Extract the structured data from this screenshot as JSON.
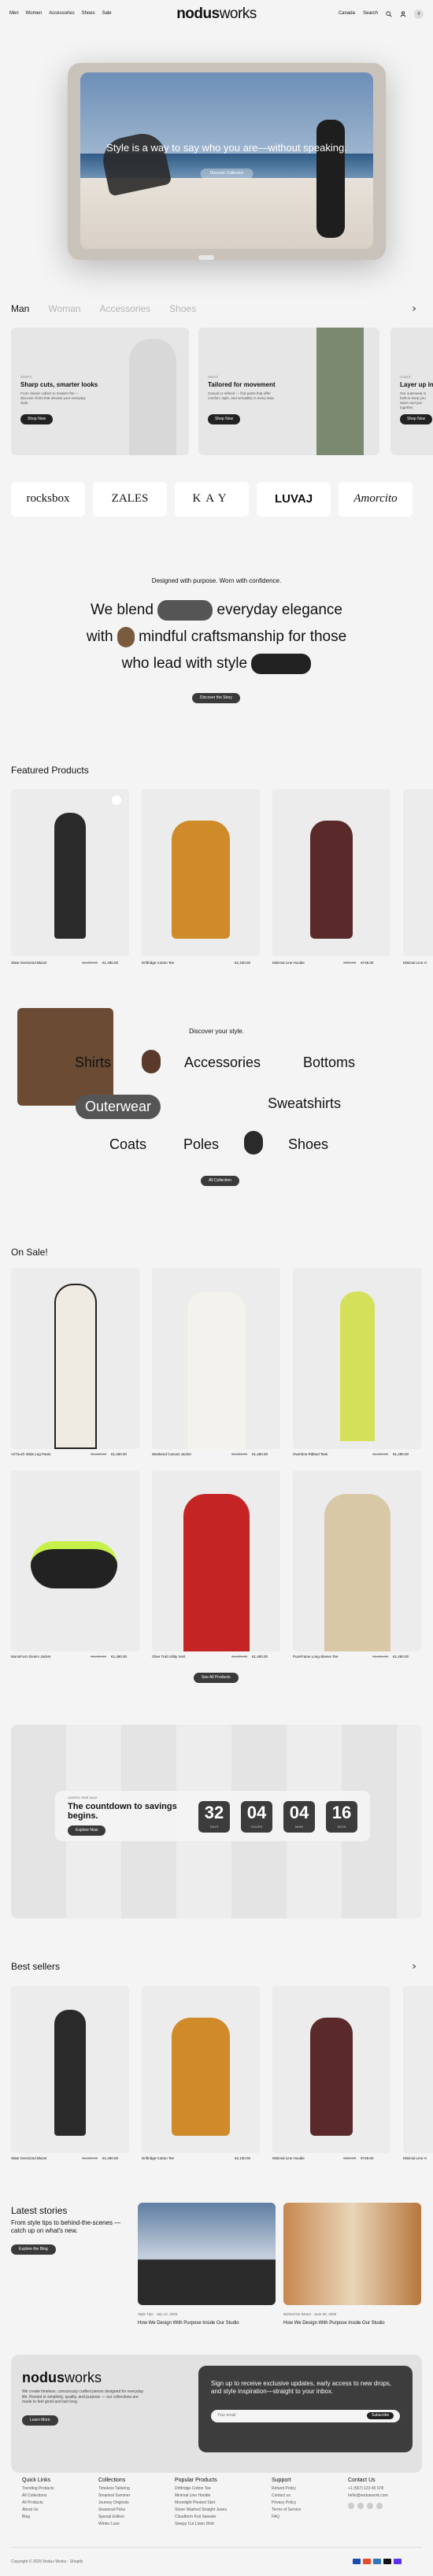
{
  "nav": {
    "left": [
      "Men",
      "Women",
      "Accessories",
      "Shoes",
      "Sale"
    ],
    "logo_bold": "nodus",
    "logo_light": "works",
    "region": "Canada",
    "search": "Search",
    "icons": [
      "search-icon",
      "account-icon",
      "cart-icon"
    ],
    "cart_count": "0"
  },
  "hero": {
    "headline": "Style is a way to say who you are—without speaking.",
    "button": "Discover Collection"
  },
  "tabs": [
    "Man",
    "Woman",
    "Accessories",
    "Shoes"
  ],
  "cards": [
    {
      "kicker": "SHIRTS",
      "title": "Sharp cuts, smarter looks",
      "desc": "From classic collars to modern fits — discover shirts that elevate your everyday style.",
      "button": "Shop Now"
    },
    {
      "kicker": "PANTS",
      "title": "Tailored for movement",
      "desc": "Casual or refined — find pants that offer comfort, style, and versatility in every step.",
      "button": "Shop Now"
    },
    {
      "kicker": "COATS",
      "title": "Layer up in style",
      "desc": "Our outerwear is built to keep you warm and put-together.",
      "button": "Shop Now"
    }
  ],
  "brands": [
    "rocksbox",
    "ZALES",
    "KAY",
    "LUVAJ",
    "Amorcito"
  ],
  "blend": {
    "kicker": "Designed with purpose. Worn with confidence.",
    "line1a": "We blend",
    "line1b": "everyday elegance",
    "line2a": "with",
    "line2b": "mindful craftsmanship for those",
    "line3a": "who lead with style",
    "button": "Discover the Story"
  },
  "featured": {
    "title": "Featured Products",
    "items": [
      {
        "name": "Slate Oversized Blazer",
        "old": "€1,890.00",
        "price": "€1,490.00"
      },
      {
        "name": "Driftridge Cotton Tee",
        "old": "",
        "price": "€2,100.00"
      },
      {
        "name": "Minimal Line Hoodie",
        "old": "€890.00",
        "price": "€749.00"
      },
      {
        "name": "Minimal Line H",
        "old": "",
        "price": ""
      }
    ]
  },
  "discover": {
    "kicker": "Discover your style.",
    "cats": [
      "Shirts",
      "Accessories",
      "Bottoms",
      "Outerwear",
      "Sweatshirts",
      "Coats",
      "Poles",
      "Shoes"
    ],
    "button": "All Collection"
  },
  "sale": {
    "title": "On Sale!",
    "items": [
      {
        "name": "AirTouch Wide Leg Pants",
        "old": "€1,890.00",
        "price": "€1,490.00"
      },
      {
        "name": "Weekend Canvas Jacket",
        "old": "€1,890.00",
        "price": "€1,490.00"
      },
      {
        "name": "Overtime Ribbed Tank",
        "old": "€1,890.00",
        "price": "€1,490.00"
      },
      {
        "name": "MonoForm Denim Jacket",
        "old": "€1,890.00",
        "price": "€1,490.00"
      },
      {
        "name": "Olive Trail Utility Vest",
        "old": "€1,890.00",
        "price": "€1,490.00"
      },
      {
        "name": "PureFrame Long-Sleeve Tee",
        "old": "€1,890.00",
        "price": "€1,490.00"
      }
    ],
    "button": "See All Products"
  },
  "countdown": {
    "kicker": "LIMITED TIME SALE",
    "title": "The countdown to savings begins.",
    "button": "Explore Now",
    "units": [
      {
        "value": "32",
        "label": "DAYS"
      },
      {
        "value": "04",
        "label": "HOURS"
      },
      {
        "value": "04",
        "label": "MINS"
      },
      {
        "value": "16",
        "label": "SECS"
      }
    ]
  },
  "best": {
    "title": "Best sellers",
    "items": [
      {
        "name": "Slate Oversized Blazer",
        "old": "€1,890.00",
        "price": "€1,490.00"
      },
      {
        "name": "Driftridge Cotton Tee",
        "old": "",
        "price": "€2,100.00"
      },
      {
        "name": "Minimal Line Hoodie",
        "old": "€890.00",
        "price": "€749.00"
      },
      {
        "name": "Minimal Line H",
        "old": "",
        "price": ""
      }
    ]
  },
  "stories": {
    "title": "Latest stories",
    "desc": "From style tips to behind-the-scenes — catch up on what's new.",
    "button": "Explore the Blog",
    "posts": [
      {
        "tag": "Style Tips",
        "date": "July 12, 2025",
        "title": "How We Design With Purpose Inside Our Studio"
      },
      {
        "tag": "Behind the Brand",
        "date": "June 30, 2025",
        "title": "How We Design With Purpose Inside Our Studio"
      }
    ]
  },
  "footer": {
    "logo_bold": "nodus",
    "logo_light": "works",
    "about": "We create timeless, consciously crafted pieces designed for everyday life. Rooted in simplicity, quality, and purpose — our collections are made to feel good and last long.",
    "learn": "Learn More",
    "news": "Sign up to receive exclusive updates, early access to new drops, and style inspiration—straight to your inbox.",
    "email_placeholder": "Your email",
    "subscribe": "Subscribe",
    "cols": [
      {
        "title": "Quick Links",
        "items": [
          "Trending Products",
          "All Collections",
          "All Products",
          "About Us",
          "Blog"
        ]
      },
      {
        "title": "Collections",
        "items": [
          "Timeless Tailoring",
          "Smartest Summer",
          "Joumey Originals",
          "Seasonal Picks",
          "Special Edition",
          "Winter Luxe"
        ]
      },
      {
        "title": "Popular Products",
        "items": [
          "Driftridge Cotton Tee",
          "Minimal Line Hoodie",
          "Moonlight Pleated Skirt",
          "Stone Washed Straight Jeans",
          "Cloudform Knit Sweater",
          "Sleepy Cut Linen Shirt"
        ]
      },
      {
        "title": "Support",
        "items": [
          "Refund Policy",
          "Contact us",
          "Privacy Policy",
          "Terms of Service",
          "FAQ"
        ]
      },
      {
        "title": "Contact Us",
        "items": [
          "+1 (567) 123 45 678",
          "hello@noduswork.com"
        ]
      }
    ],
    "copyright": "Copyright © 2025 Nodus Works - Shopify"
  }
}
